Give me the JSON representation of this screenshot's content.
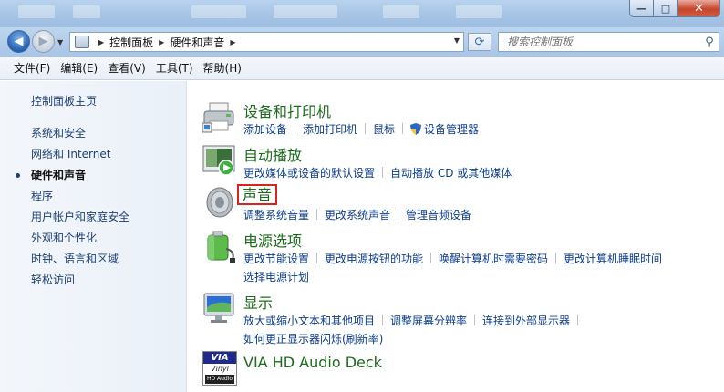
{
  "window": {
    "minimize_glyph": "—",
    "maximize_glyph": "□",
    "close_glyph": "✕"
  },
  "address": {
    "crumbs": [
      "控制面板",
      "硬件和声音"
    ],
    "search_placeholder": "搜索控制面板"
  },
  "menu": [
    "文件(F)",
    "编辑(E)",
    "查看(V)",
    "工具(T)",
    "帮助(H)"
  ],
  "leftnav": {
    "home": "控制面板主页",
    "items": [
      "系统和安全",
      "网络和 Internet",
      "硬件和声音",
      "程序",
      "用户帐户和家庭安全",
      "外观和个性化",
      "时钟、语言和区域",
      "轻松访问"
    ],
    "active_index": 2
  },
  "categories": [
    {
      "icon": "printer-icon",
      "title": "设备和打印机",
      "links": [
        "添加设备",
        "添加打印机",
        "鼠标",
        "设备管理器"
      ]
    },
    {
      "icon": "autoplay-icon",
      "title": "自动播放",
      "links": [
        "更改媒体或设备的默认设置",
        "自动播放 CD 或其他媒体"
      ]
    },
    {
      "icon": "speaker-icon",
      "title": "声音",
      "highlighted": true,
      "links": [
        "调整系统音量",
        "更改系统声音",
        "管理音频设备"
      ]
    },
    {
      "icon": "battery-icon",
      "title": "电源选项",
      "links": [
        "更改节能设置",
        "更改电源按钮的功能",
        "唤醒计算机时需要密码",
        "更改计算机睡眠时间"
      ],
      "links2": [
        "选择电源计划"
      ]
    },
    {
      "icon": "monitor-icon",
      "title": "显示",
      "links": [
        "放大或缩小文本和其他项目",
        "调整屏幕分辨率",
        "连接到外部显示器"
      ],
      "links2": [
        "如何更正显示器闪烁(刷新率)"
      ]
    },
    {
      "icon": "via-vinyl-icon",
      "title": "VIA HD Audio Deck",
      "icon_text": [
        "VIA",
        "Vinyl",
        "HD Audio"
      ]
    }
  ],
  "colors": {
    "category_title": "#1d6b1d",
    "link": "#0d3d8a",
    "highlight_box": "#d8231f"
  }
}
